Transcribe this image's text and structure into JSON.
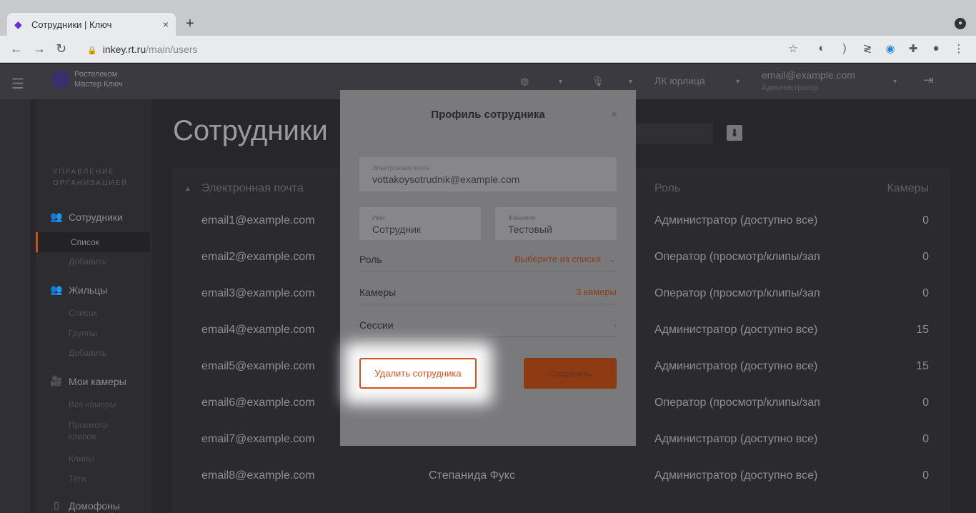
{
  "browser": {
    "tab_title": "Сотрудники | Ключ",
    "tab_close": "×",
    "new_tab": "+",
    "url_host": "inkey.rt.ru",
    "url_path": "/main/users"
  },
  "header": {
    "logo_line1": "Ростелеком",
    "logo_line2": "Мастер Ключ",
    "account_label": "ЛК юрлица",
    "user_email": "email@example.com",
    "user_role": "Администратор"
  },
  "sidebar": {
    "section_title_1": "УПРАВЛЕНИЕ",
    "section_title_2": "ОРГАНИЗАЦИЕЙ",
    "employees": "Сотрудники",
    "employees_list": "Список",
    "employees_add": "Добавить",
    "residents": "Жильцы",
    "residents_list": "Список",
    "residents_groups": "Группы",
    "residents_add": "Добавить",
    "cameras": "Мои камеры",
    "cameras_all": "Все камеры",
    "cameras_clips_1": "Просмотр",
    "cameras_clips_2": "клипов",
    "cameras_clips": "Клипы",
    "cameras_tags": "Теги",
    "intercoms": "Домофоны"
  },
  "main": {
    "page_title": "Сотрудники",
    "columns": {
      "email": "Электронная почта",
      "role": "Роль",
      "cameras": "Камеры"
    },
    "rows": [
      {
        "email": "email1@example.com",
        "name": "",
        "role": "Администратор (доступно все)",
        "cameras": "0"
      },
      {
        "email": "email2@example.com",
        "name": "",
        "role": "Оператор (просмотр/клипы/зап",
        "cameras": "0"
      },
      {
        "email": "email3@example.com",
        "name": "",
        "role": "Оператор (просмотр/клипы/зап",
        "cameras": "0"
      },
      {
        "email": "email4@example.com",
        "name": "",
        "role": "Администратор (доступно все)",
        "cameras": "15"
      },
      {
        "email": "email5@example.com",
        "name": "",
        "role": "Администратор (доступно все)",
        "cameras": "15"
      },
      {
        "email": "email6@example.com",
        "name": "",
        "role": "Оператор (просмотр/клипы/зап",
        "cameras": "0"
      },
      {
        "email": "email7@example.com",
        "name": "",
        "role": "Администратор (доступно все)",
        "cameras": "0"
      },
      {
        "email": "email8@example.com",
        "name": "Степанида Фукс",
        "role": "Администратор (доступно все)",
        "cameras": "0"
      }
    ]
  },
  "modal": {
    "title": "Профиль сотрудника",
    "close": "×",
    "email_label": "Электронная почта",
    "email_value": "vottakoysotrudnik@example.com",
    "first_name_label": "Имя",
    "first_name_value": "Сотрудник",
    "last_name_label": "Фамилия",
    "last_name_value": "Тестовый",
    "role_label": "Роль",
    "role_value": "Выберите из списка",
    "cameras_label": "Камеры",
    "cameras_value": "3 камеры",
    "sessions_label": "Сессии",
    "delete_button": "Удалить сотрудника",
    "save_button": "Сохранить"
  },
  "colors": {
    "accent": "#d9531e",
    "overlay_bg": "#26262b"
  }
}
